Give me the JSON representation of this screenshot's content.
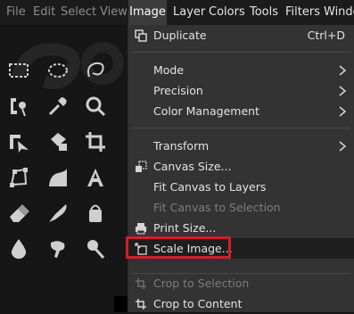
{
  "menubar": {
    "items": [
      {
        "label": "File",
        "state": "normal"
      },
      {
        "label": "Edit",
        "state": "normal"
      },
      {
        "label": "Select",
        "state": "normal"
      },
      {
        "label": "View",
        "state": "normal"
      },
      {
        "label": "Image",
        "state": "active"
      },
      {
        "label": "Layer",
        "state": "enabled"
      },
      {
        "label": "Colors",
        "state": "enabled"
      },
      {
        "label": "Tools",
        "state": "enabled"
      },
      {
        "label": "Filters",
        "state": "enabled"
      },
      {
        "label": "Windo",
        "state": "enabled"
      }
    ]
  },
  "image_menu": {
    "duplicate": {
      "label": "Duplicate",
      "shortcut": "Ctrl+D",
      "icon": "duplicate-icon"
    },
    "mode": {
      "label": "Mode"
    },
    "precision": {
      "label": "Precision"
    },
    "color_management": {
      "label": "Color Management"
    },
    "transform": {
      "label": "Transform"
    },
    "canvas_size": {
      "label": "Canvas Size...",
      "icon": "canvas-size-icon"
    },
    "fit_canvas_layers": {
      "label": "Fit Canvas to Layers"
    },
    "fit_canvas_selection": {
      "label": "Fit Canvas to Selection",
      "disabled": true
    },
    "print_size": {
      "label": "Print Size...",
      "icon": "printer-icon"
    },
    "scale_image": {
      "label": "Scale Image...",
      "icon": "scale-image-icon",
      "hovered": true
    },
    "crop_selection": {
      "label": "Crop to Selection",
      "disabled": true,
      "icon": "crop-icon"
    },
    "crop_content": {
      "label": "Crop to Content",
      "icon": "crop-icon"
    }
  },
  "colors": {
    "highlight_border": "#d01e2e",
    "menu_bg": "#333333",
    "menubar_bg": "#1b1b1b"
  }
}
